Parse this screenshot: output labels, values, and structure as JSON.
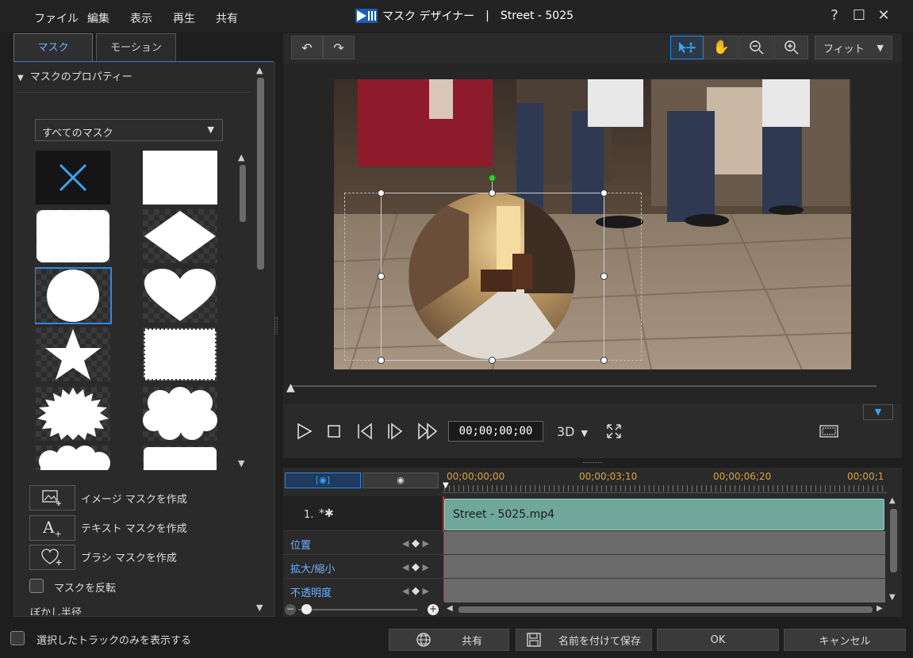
{
  "menu": {
    "file": "ファイル",
    "edit": "編集",
    "view": "表示",
    "play": "再生",
    "share": "共有"
  },
  "window": {
    "title": "マスク デザイナー",
    "separator": "|",
    "project": "Street - 5025",
    "help": "?",
    "max": "☐",
    "close": "✕"
  },
  "tabs": {
    "mask": "マスク",
    "motion": "モーション"
  },
  "left": {
    "section_title": "マスクのプロパティー",
    "filter": "すべてのマスク",
    "create_image": "イメージ マスクを作成",
    "create_text": "テキスト マスクを作成",
    "create_brush": "ブラシ マスクを作成",
    "invert": "マスクを反転",
    "blur_radius": "ぼかし半径"
  },
  "toolbar": {
    "zoom_select": "フィット"
  },
  "player": {
    "timecode": "00;00;00;00",
    "mode": "3D"
  },
  "timeline": {
    "ruler": [
      "00;00;00;00",
      "00;00;03;10",
      "00;00;06;20",
      "00;00;1"
    ],
    "track_index": "1.",
    "clip_name": "Street - 5025.mp4",
    "rows": [
      "位置",
      "拡大/縮小",
      "不透明度"
    ]
  },
  "footer": {
    "only_selected": "選択したトラックのみを表示する",
    "share": "共有",
    "save_as": "名前を付けて保存",
    "ok": "OK",
    "cancel": "キャンセル"
  },
  "colors": {
    "accent": "#2d8ae8",
    "clip": "#6fa89a",
    "ruler_text": "#d9a441"
  }
}
